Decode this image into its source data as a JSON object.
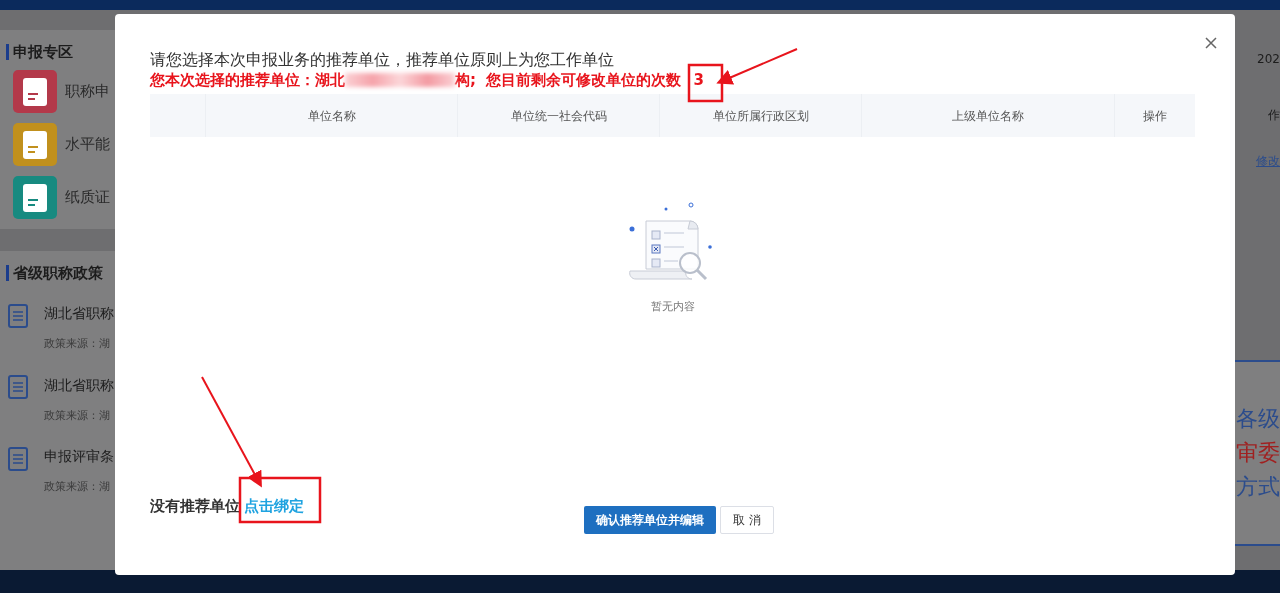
{
  "background_page": {
    "sections": [
      {
        "title": "申报专区",
        "items": [
          {
            "label": "职称申",
            "color": "#b3394a"
          },
          {
            "label": "水平能",
            "color": "#c1901d"
          },
          {
            "label": "纸质证",
            "color": "#178a80"
          }
        ]
      },
      {
        "title": "省级职称政策",
        "policies": [
          {
            "title": "湖北省职称",
            "source": "政策来源：湖"
          },
          {
            "title": "湖北省职称",
            "source": "政策来源：湖"
          },
          {
            "title": "申报评审条",
            "source": "政策来源：湖"
          }
        ]
      }
    ],
    "right_edge": {
      "date": "202",
      "column_header": "作",
      "link": "修改",
      "notice_lines": [
        {
          "text": "各级",
          "color": "#2b4c8c"
        },
        {
          "text": "审委",
          "color": "#a02020"
        },
        {
          "text": "方式",
          "color": "#2b4c8c"
        }
      ]
    }
  },
  "dialog": {
    "title": "请您选择本次申报业务的推荐单位，推荐单位原则上为您工作单位",
    "selection_prefix": "您本次选择的推荐单位：湖北",
    "selection_suffix": "构;  您目前剩余可修改单位的次数",
    "remaining_count": "3",
    "table": {
      "columns": [
        "单位名称",
        "单位统一社会代码",
        "单位所属行政区划",
        "上级单位名称",
        "操作"
      ]
    },
    "empty_text": "暂无内容",
    "no_unit_text": "没有推荐单位",
    "bind_link": "点击绑定",
    "buttons": [
      {
        "label": "确认推荐单位并编辑",
        "kind": "primary"
      },
      {
        "label": "取 消",
        "kind": "default"
      }
    ]
  }
}
